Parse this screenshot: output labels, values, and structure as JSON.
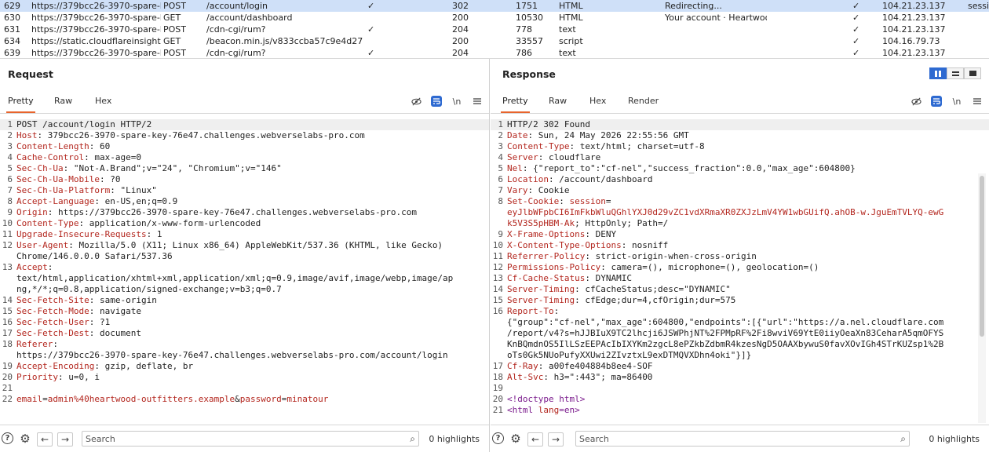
{
  "history": {
    "rows": [
      {
        "num": "629",
        "host": "https://379bcc26-3970-spare-k...",
        "method": "POST",
        "path": "/account/login",
        "edited": "✓",
        "status": "302",
        "length": "1751",
        "mime": "HTML",
        "title": "Redirecting...",
        "tls": "✓",
        "ip": "104.21.23.137",
        "cookies": "sessi",
        "selected": true
      },
      {
        "num": "630",
        "host": "https://379bcc26-3970-spare-k...",
        "method": "GET",
        "path": "/account/dashboard",
        "edited": "",
        "status": "200",
        "length": "10530",
        "mime": "HTML",
        "title": "Your account · Heartwoo...",
        "tls": "✓",
        "ip": "104.21.23.137",
        "cookies": ""
      },
      {
        "num": "631",
        "host": "https://379bcc26-3970-spare-k...",
        "method": "POST",
        "path": "/cdn-cgi/rum?",
        "edited": "✓",
        "status": "204",
        "length": "778",
        "mime": "text",
        "title": "",
        "tls": "✓",
        "ip": "104.21.23.137",
        "cookies": ""
      },
      {
        "num": "634",
        "host": "https://static.cloudflareinsights...",
        "method": "GET",
        "path": "/beacon.min.js/v833ccba57c9e4d2798...",
        "edited": "",
        "status": "200",
        "length": "33557",
        "mime": "script",
        "title": "",
        "tls": "✓",
        "ip": "104.16.79.73",
        "cookies": ""
      },
      {
        "num": "639",
        "host": "https://379bcc26-3970-spare-k...",
        "method": "POST",
        "path": "/cdn-cgi/rum?",
        "edited": "✓",
        "status": "204",
        "length": "786",
        "mime": "text",
        "title": "",
        "tls": "✓",
        "ip": "104.21.23.137",
        "cookies": ""
      }
    ]
  },
  "request": {
    "title": "Request",
    "tabs": [
      "Pretty",
      "Raw",
      "Hex"
    ],
    "active_tab": "Pretty",
    "newline_label": "\\n",
    "search_placeholder": "Search",
    "highlights": "0 highlights",
    "lines": [
      {
        "n": "1",
        "parts": [
          {
            "t": "POST /account/login HTTP/2",
            "c": "val"
          }
        ]
      },
      {
        "n": "2",
        "parts": [
          {
            "t": "Host",
            "c": "hk"
          },
          {
            "t": ": 379bcc26-3970-spare-key-76e47.challenges.webverselabs-pro.com",
            "c": "val"
          }
        ]
      },
      {
        "n": "3",
        "parts": [
          {
            "t": "Content-Length",
            "c": "hk"
          },
          {
            "t": ": 60",
            "c": "val"
          }
        ]
      },
      {
        "n": "4",
        "parts": [
          {
            "t": "Cache-Control",
            "c": "hk"
          },
          {
            "t": ": max-age=0",
            "c": "val"
          }
        ]
      },
      {
        "n": "5",
        "parts": [
          {
            "t": "Sec-Ch-Ua",
            "c": "hk"
          },
          {
            "t": ": \"Not-A.Brand\";v=\"24\", \"Chromium\";v=\"146\"",
            "c": "val"
          }
        ]
      },
      {
        "n": "6",
        "parts": [
          {
            "t": "Sec-Ch-Ua-Mobile",
            "c": "hk"
          },
          {
            "t": ": ?0",
            "c": "val"
          }
        ]
      },
      {
        "n": "7",
        "parts": [
          {
            "t": "Sec-Ch-Ua-Platform",
            "c": "hk"
          },
          {
            "t": ": \"Linux\"",
            "c": "val"
          }
        ]
      },
      {
        "n": "8",
        "parts": [
          {
            "t": "Accept-Language",
            "c": "hk"
          },
          {
            "t": ": en-US,en;q=0.9",
            "c": "val"
          }
        ]
      },
      {
        "n": "9",
        "parts": [
          {
            "t": "Origin",
            "c": "hk"
          },
          {
            "t": ": https://379bcc26-3970-spare-key-76e47.challenges.webverselabs-pro.com",
            "c": "val"
          }
        ]
      },
      {
        "n": "10",
        "parts": [
          {
            "t": "Content-Type",
            "c": "hk"
          },
          {
            "t": ": application/x-www-form-urlencoded",
            "c": "val"
          }
        ]
      },
      {
        "n": "11",
        "parts": [
          {
            "t": "Upgrade-Insecure-Requests",
            "c": "hk"
          },
          {
            "t": ": 1",
            "c": "val"
          }
        ]
      },
      {
        "n": "12",
        "parts": [
          {
            "t": "User-Agent",
            "c": "hk"
          },
          {
            "t": ": Mozilla/5.0 (X11; Linux x86_64) AppleWebKit/537.36 (KHTML, like Gecko)",
            "c": "val"
          }
        ]
      },
      {
        "n": "",
        "parts": [
          {
            "t": "Chrome/146.0.0.0 Safari/537.36",
            "c": "val"
          }
        ]
      },
      {
        "n": "13",
        "parts": [
          {
            "t": "Accept",
            "c": "hk"
          },
          {
            "t": ":",
            "c": "val"
          }
        ]
      },
      {
        "n": "",
        "parts": [
          {
            "t": "text/html,application/xhtml+xml,application/xml;q=0.9,image/avif,image/webp,image/ap",
            "c": "val"
          }
        ]
      },
      {
        "n": "",
        "parts": [
          {
            "t": "ng,*/*;q=0.8,application/signed-exchange;v=b3;q=0.7",
            "c": "val"
          }
        ]
      },
      {
        "n": "14",
        "parts": [
          {
            "t": "Sec-Fetch-Site",
            "c": "hk"
          },
          {
            "t": ": same-origin",
            "c": "val"
          }
        ]
      },
      {
        "n": "15",
        "parts": [
          {
            "t": "Sec-Fetch-Mode",
            "c": "hk"
          },
          {
            "t": ": navigate",
            "c": "val"
          }
        ]
      },
      {
        "n": "16",
        "parts": [
          {
            "t": "Sec-Fetch-User",
            "c": "hk"
          },
          {
            "t": ": ?1",
            "c": "val"
          }
        ]
      },
      {
        "n": "17",
        "parts": [
          {
            "t": "Sec-Fetch-Dest",
            "c": "hk"
          },
          {
            "t": ": document",
            "c": "val"
          }
        ]
      },
      {
        "n": "18",
        "parts": [
          {
            "t": "Referer",
            "c": "hk"
          },
          {
            "t": ":",
            "c": "val"
          }
        ]
      },
      {
        "n": "",
        "parts": [
          {
            "t": "https://379bcc26-3970-spare-key-76e47.challenges.webverselabs-pro.com/account/login",
            "c": "val"
          }
        ]
      },
      {
        "n": "19",
        "parts": [
          {
            "t": "Accept-Encoding",
            "c": "hk"
          },
          {
            "t": ": gzip, deflate, br",
            "c": "val"
          }
        ]
      },
      {
        "n": "20",
        "parts": [
          {
            "t": "Priority",
            "c": "hk"
          },
          {
            "t": ": u=0, i",
            "c": "val"
          }
        ]
      },
      {
        "n": "21",
        "parts": []
      },
      {
        "n": "22",
        "parts": [
          {
            "t": "email",
            "c": "pn"
          },
          {
            "t": "=",
            "c": "val"
          },
          {
            "t": "admin%40heartwood-outfitters.example",
            "c": "pv"
          },
          {
            "t": "&",
            "c": "val"
          },
          {
            "t": "password",
            "c": "pn"
          },
          {
            "t": "=",
            "c": "val"
          },
          {
            "t": "minatour",
            "c": "pv"
          }
        ]
      }
    ]
  },
  "response": {
    "title": "Response",
    "tabs": [
      "Pretty",
      "Raw",
      "Hex",
      "Render"
    ],
    "active_tab": "Pretty",
    "newline_label": "\\n",
    "search_placeholder": "Search",
    "highlights": "0 highlights",
    "lines": [
      {
        "n": "1",
        "parts": [
          {
            "t": "HTTP/2 302 Found",
            "c": "val"
          }
        ]
      },
      {
        "n": "2",
        "parts": [
          {
            "t": "Date",
            "c": "hk"
          },
          {
            "t": ": Sun, 24 May 2026 22:55:56 GMT",
            "c": "val"
          }
        ]
      },
      {
        "n": "3",
        "parts": [
          {
            "t": "Content-Type",
            "c": "hk"
          },
          {
            "t": ": text/html; charset=utf-8",
            "c": "val"
          }
        ]
      },
      {
        "n": "4",
        "parts": [
          {
            "t": "Server",
            "c": "hk"
          },
          {
            "t": ": cloudflare",
            "c": "val"
          }
        ]
      },
      {
        "n": "5",
        "parts": [
          {
            "t": "Nel",
            "c": "hk"
          },
          {
            "t": ": {\"report_to\":\"cf-nel\",\"success_fraction\":0.0,\"max_age\":604800}",
            "c": "val"
          }
        ]
      },
      {
        "n": "6",
        "parts": [
          {
            "t": "Location",
            "c": "hk"
          },
          {
            "t": ": /account/dashboard",
            "c": "val"
          }
        ]
      },
      {
        "n": "7",
        "parts": [
          {
            "t": "Vary",
            "c": "hk"
          },
          {
            "t": ": Cookie",
            "c": "val"
          }
        ]
      },
      {
        "n": "8",
        "parts": [
          {
            "t": "Set-Cookie",
            "c": "hk"
          },
          {
            "t": ": ",
            "c": "val"
          },
          {
            "t": "session",
            "c": "hk"
          },
          {
            "t": "=",
            "c": "val"
          }
        ]
      },
      {
        "n": "",
        "parts": [
          {
            "t": "eyJlbWFpbCI6ImFkbWluQGhlYXJ0d29vZC1vdXRmaXR0ZXJzLmV4YW1wbGUifQ.ahOB-w.JguEmTVLYQ-ewG",
            "c": "red"
          }
        ]
      },
      {
        "n": "",
        "parts": [
          {
            "t": "k5V3S5pHBM-Ak",
            "c": "red"
          },
          {
            "t": "; HttpOnly; Path=/",
            "c": "val"
          }
        ]
      },
      {
        "n": "9",
        "parts": [
          {
            "t": "X-Frame-Options",
            "c": "hk"
          },
          {
            "t": ": DENY",
            "c": "val"
          }
        ]
      },
      {
        "n": "10",
        "parts": [
          {
            "t": "X-Content-Type-Options",
            "c": "hk"
          },
          {
            "t": ": nosniff",
            "c": "val"
          }
        ]
      },
      {
        "n": "11",
        "parts": [
          {
            "t": "Referrer-Policy",
            "c": "hk"
          },
          {
            "t": ": strict-origin-when-cross-origin",
            "c": "val"
          }
        ]
      },
      {
        "n": "12",
        "parts": [
          {
            "t": "Permissions-Policy",
            "c": "hk"
          },
          {
            "t": ": camera=(), microphone=(), geolocation=()",
            "c": "val"
          }
        ]
      },
      {
        "n": "13",
        "parts": [
          {
            "t": "Cf-Cache-Status",
            "c": "hk"
          },
          {
            "t": ": DYNAMIC",
            "c": "val"
          }
        ]
      },
      {
        "n": "14",
        "parts": [
          {
            "t": "Server-Timing",
            "c": "hk"
          },
          {
            "t": ": cfCacheStatus;desc=\"DYNAMIC\"",
            "c": "val"
          }
        ]
      },
      {
        "n": "15",
        "parts": [
          {
            "t": "Server-Timing",
            "c": "hk"
          },
          {
            "t": ": cfEdge;dur=4,cfOrigin;dur=575",
            "c": "val"
          }
        ]
      },
      {
        "n": "16",
        "parts": [
          {
            "t": "Report-To",
            "c": "hk"
          },
          {
            "t": ":",
            "c": "val"
          }
        ]
      },
      {
        "n": "",
        "parts": [
          {
            "t": "{\"group\":\"cf-nel\",\"max_age\":604800,\"endpoints\":[{\"url\":\"https://a.nel.cloudflare.com",
            "c": "val"
          }
        ]
      },
      {
        "n": "",
        "parts": [
          {
            "t": "/report/v4?s=hJJBIuX9TC2lhcji6JSWPhjNT%2FPMpRF%2Fi8wviV69YtE0iiyOeaXn83CeharA5qmOFYS",
            "c": "val"
          }
        ]
      },
      {
        "n": "",
        "parts": [
          {
            "t": "KnBQmdnOS5IlLSzEEPAcIbIXYKm2zgcL8ePZkbZdbmR4kzesNgD5OAAXbywuS0favXOvIGh4STrKUZsp1%2B",
            "c": "val"
          }
        ]
      },
      {
        "n": "",
        "parts": [
          {
            "t": "oTs0Gk5NUoPufyXXUwi2ZIvztxL9exDTMQVXDhn4oki\"}]}",
            "c": "val"
          }
        ]
      },
      {
        "n": "17",
        "parts": [
          {
            "t": "Cf-Ray",
            "c": "hk"
          },
          {
            "t": ": a00fe404884b8ee4-SOF",
            "c": "val"
          }
        ]
      },
      {
        "n": "18",
        "parts": [
          {
            "t": "Alt-Svc",
            "c": "hk"
          },
          {
            "t": ": h3=\":443\"; ma=86400",
            "c": "val"
          }
        ]
      },
      {
        "n": "19",
        "parts": []
      },
      {
        "n": "20",
        "parts": [
          {
            "t": "<!doctype html>",
            "c": "tagc"
          }
        ]
      },
      {
        "n": "21",
        "parts": [
          {
            "t": "<html ",
            "c": "tagc"
          },
          {
            "t": "lang",
            "c": "attr"
          },
          {
            "t": "=en>",
            "c": "tagc"
          }
        ]
      }
    ]
  }
}
